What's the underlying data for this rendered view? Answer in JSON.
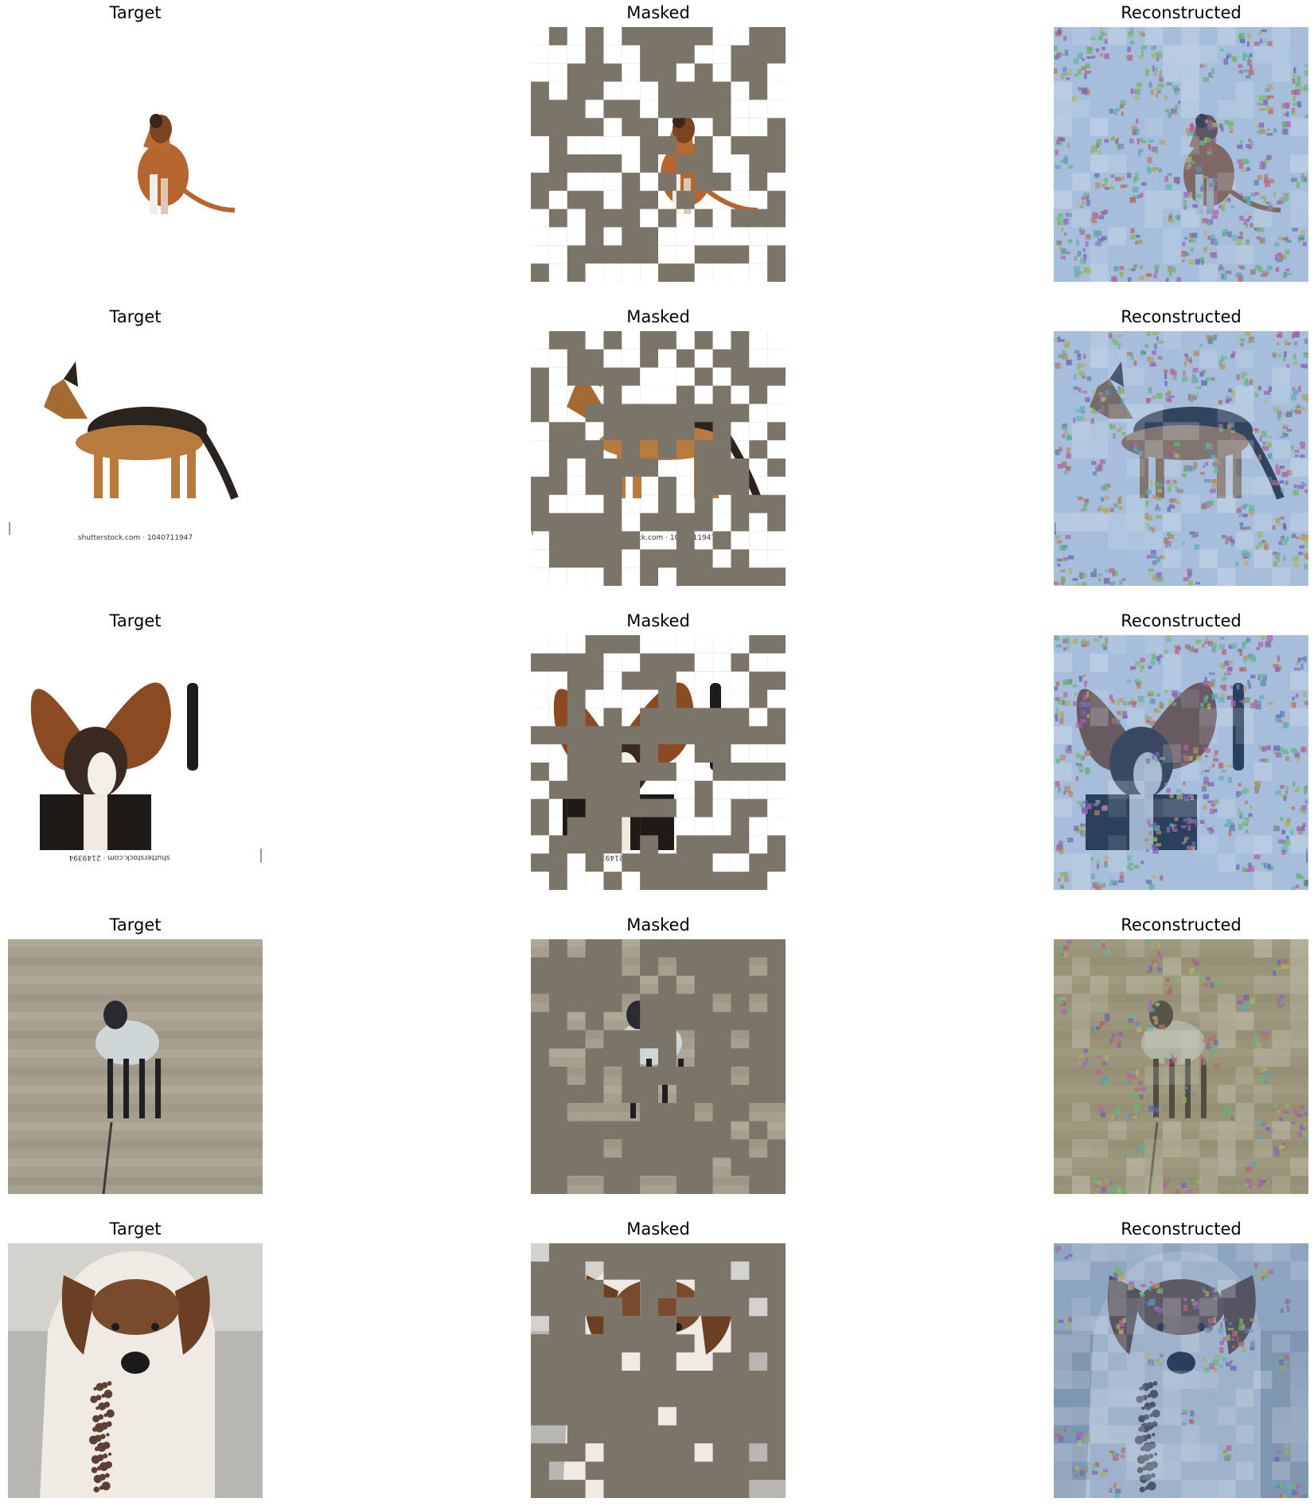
{
  "colors": {
    "background": "#ffffff",
    "mask_fill": "#7b7468",
    "recon_blue": "#3b6fb0",
    "recon_dirt": "#8c8a62",
    "target_white": "#ffffff"
  },
  "grid": {
    "patches_per_side": 14
  },
  "rows": [
    {
      "titles": {
        "target": "Target",
        "masked": "Masked",
        "reconstructed": "Reconstructed"
      },
      "subject": "dog-boxer-sitting",
      "watermark": "",
      "mask_pattern": "sparse"
    },
    {
      "titles": {
        "target": "Target",
        "masked": "Masked",
        "reconstructed": "Reconstructed"
      },
      "subject": "dog-german-shepherd-standing",
      "watermark": "shutterstock.com · 1040711947",
      "mask_pattern": "sparse"
    },
    {
      "titles": {
        "target": "Target",
        "masked": "Masked",
        "reconstructed": "Reconstructed"
      },
      "subject": "dog-floppy-ears-with-phone",
      "watermark": "shutterstock.com · 2149394",
      "mask_pattern": "sparse"
    },
    {
      "titles": {
        "target": "Target",
        "masked": "Masked",
        "reconstructed": "Reconstructed"
      },
      "subject": "dog-on-beach-water",
      "watermark": "",
      "mask_pattern": "dense"
    },
    {
      "titles": {
        "target": "Target",
        "masked": "Masked",
        "reconstructed": "Reconstructed"
      },
      "subject": "dog-spotted-lying",
      "watermark": "",
      "mask_pattern": "dense"
    }
  ]
}
